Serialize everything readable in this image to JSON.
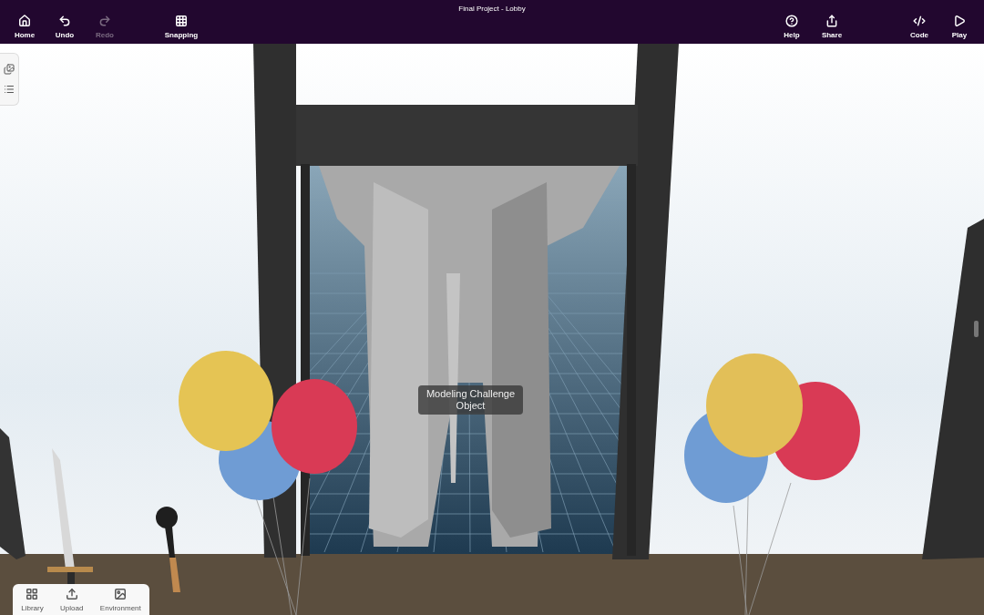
{
  "window": {
    "title": "Final Project - Lobby"
  },
  "toolbar_left": [
    {
      "kind": "home",
      "label": "Home",
      "disabled": false
    },
    {
      "kind": "undo",
      "label": "Undo",
      "disabled": false
    },
    {
      "kind": "redo",
      "label": "Redo",
      "disabled": true
    }
  ],
  "toolbar_center": [
    {
      "kind": "snapping",
      "label": "Snapping",
      "disabled": false
    }
  ],
  "toolbar_right": [
    {
      "kind": "help",
      "label": "Help",
      "disabled": false
    },
    {
      "kind": "share",
      "label": "Share",
      "disabled": false
    }
  ],
  "toolbar_far_right": [
    {
      "kind": "code",
      "label": "Code",
      "disabled": false
    },
    {
      "kind": "play",
      "label": "Play",
      "disabled": false
    }
  ],
  "bottom_bar": [
    {
      "kind": "library",
      "label": "Library"
    },
    {
      "kind": "upload",
      "label": "Upload"
    },
    {
      "kind": "environment",
      "label": "Environment"
    }
  ],
  "object_label": "Modeling Challenge Object"
}
